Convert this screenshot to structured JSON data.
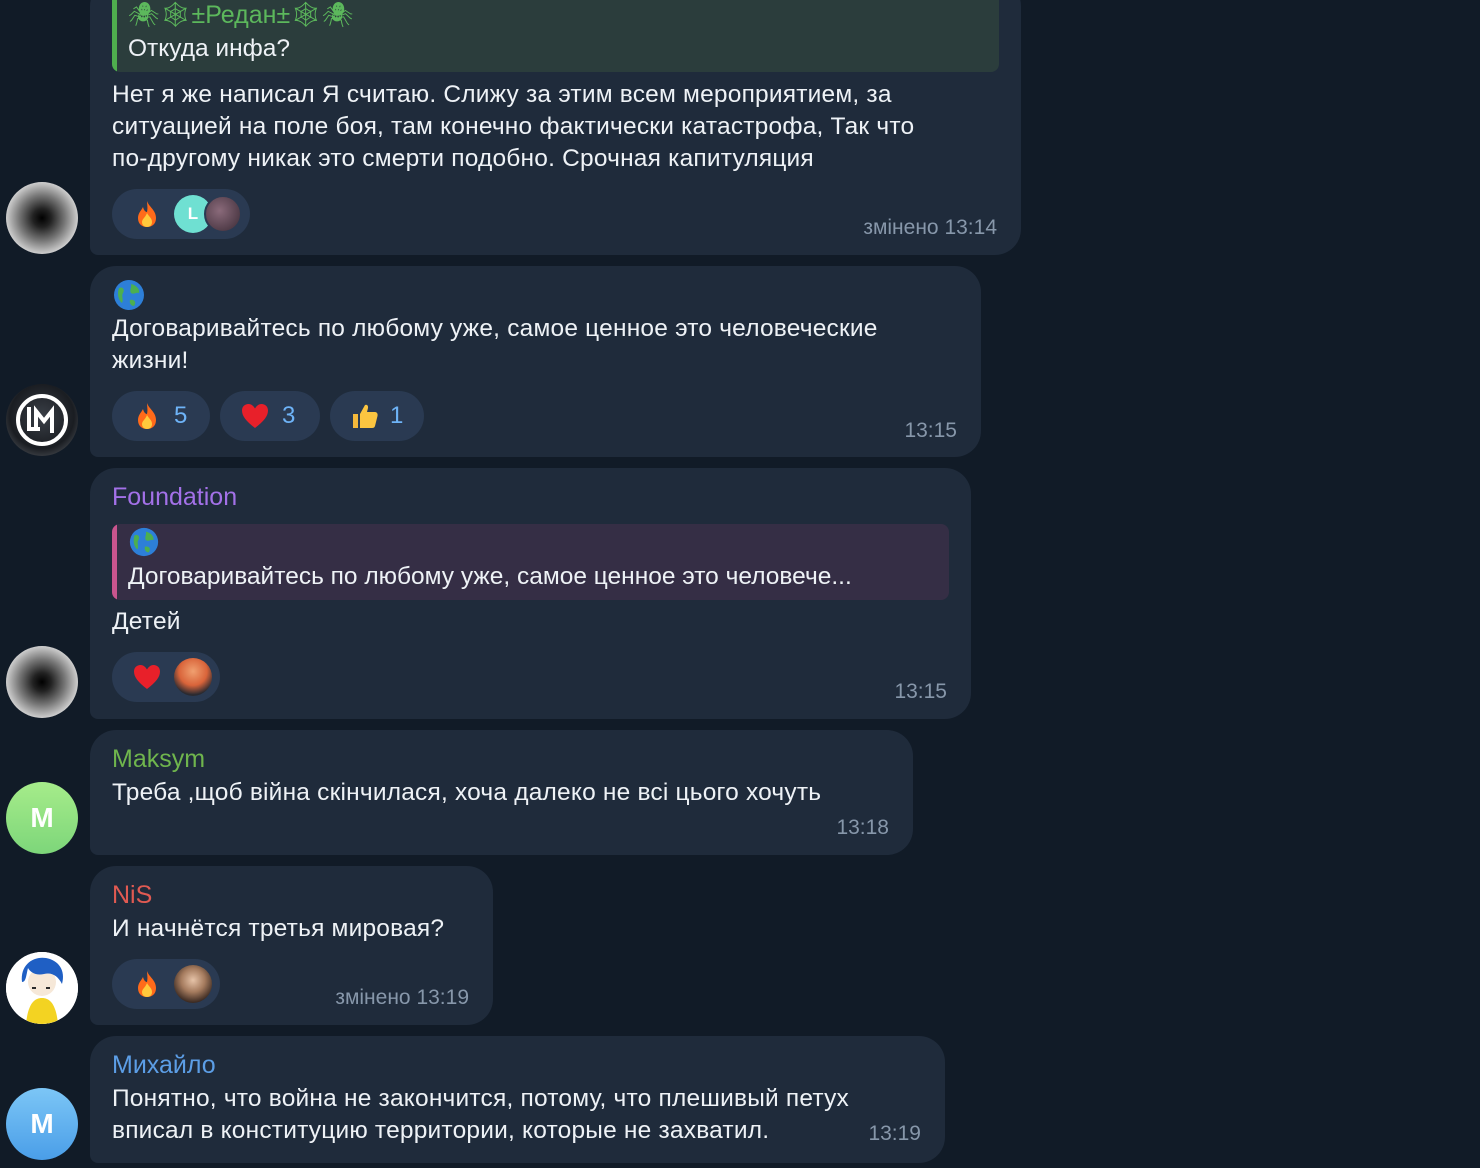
{
  "messages": [
    {
      "quote": {
        "author": "±Редан±",
        "text": "Откуда инфа?"
      },
      "text_lines": [
        "Нет я же написал Я считаю. Слижу за этим всем мероприятием, за",
        "ситуацией на поле боя, там конечно  фактически катастрофа, Так что",
        "по-другому никак это смерти подобно. Срочная капитуляция"
      ],
      "reaction_emoji": "fire",
      "reactor_initial": "L",
      "time": "змінено 13:14"
    },
    {
      "text_lines": [
        "Договаривайтесь по любому уже, самое ценное это человеческие",
        "жизни!"
      ],
      "reactions": [
        {
          "emoji": "fire",
          "count": "5"
        },
        {
          "emoji": "heart",
          "count": "3"
        },
        {
          "emoji": "thumbs-up",
          "count": "1"
        }
      ],
      "avatar_initials": "LM",
      "time": "13:15"
    },
    {
      "author": "Foundation",
      "quote": {
        "text": "Договаривайтесь по любому уже, самое ценное это человече..."
      },
      "text": "Детей",
      "reaction_emoji": "heart",
      "time": "13:15"
    },
    {
      "author": "Maksym",
      "avatar_initial": "M",
      "text": "Треба ,щоб війна скінчилася, хоча далеко не всі цього хочуть",
      "time": "13:18"
    },
    {
      "author": "NiS",
      "text": "И начнётся третья мировая?",
      "reaction_emoji": "fire",
      "time": "змінено 13:19"
    },
    {
      "author": "Михайло",
      "avatar_initial": "M",
      "text_lines": [
        "Понятно, что война не закончится, потому, что плешивый петух",
        "вписал в конституцию территории, которые не захватил."
      ],
      "time": "13:19"
    }
  ],
  "colors": {
    "background": "#111b27",
    "bubble": "#1f2b3b",
    "reaction_bg": "#2a3a52",
    "reaction_count": "#6eb3f7",
    "time": "#8797aa",
    "author_foundation": "#a371e8",
    "author_maksym": "#6fb54d",
    "author_nis": "#e05a52",
    "author_mykhailo": "#5c9ee6",
    "quote_green": "#4fae4e",
    "quote_pink": "#c9558e"
  }
}
